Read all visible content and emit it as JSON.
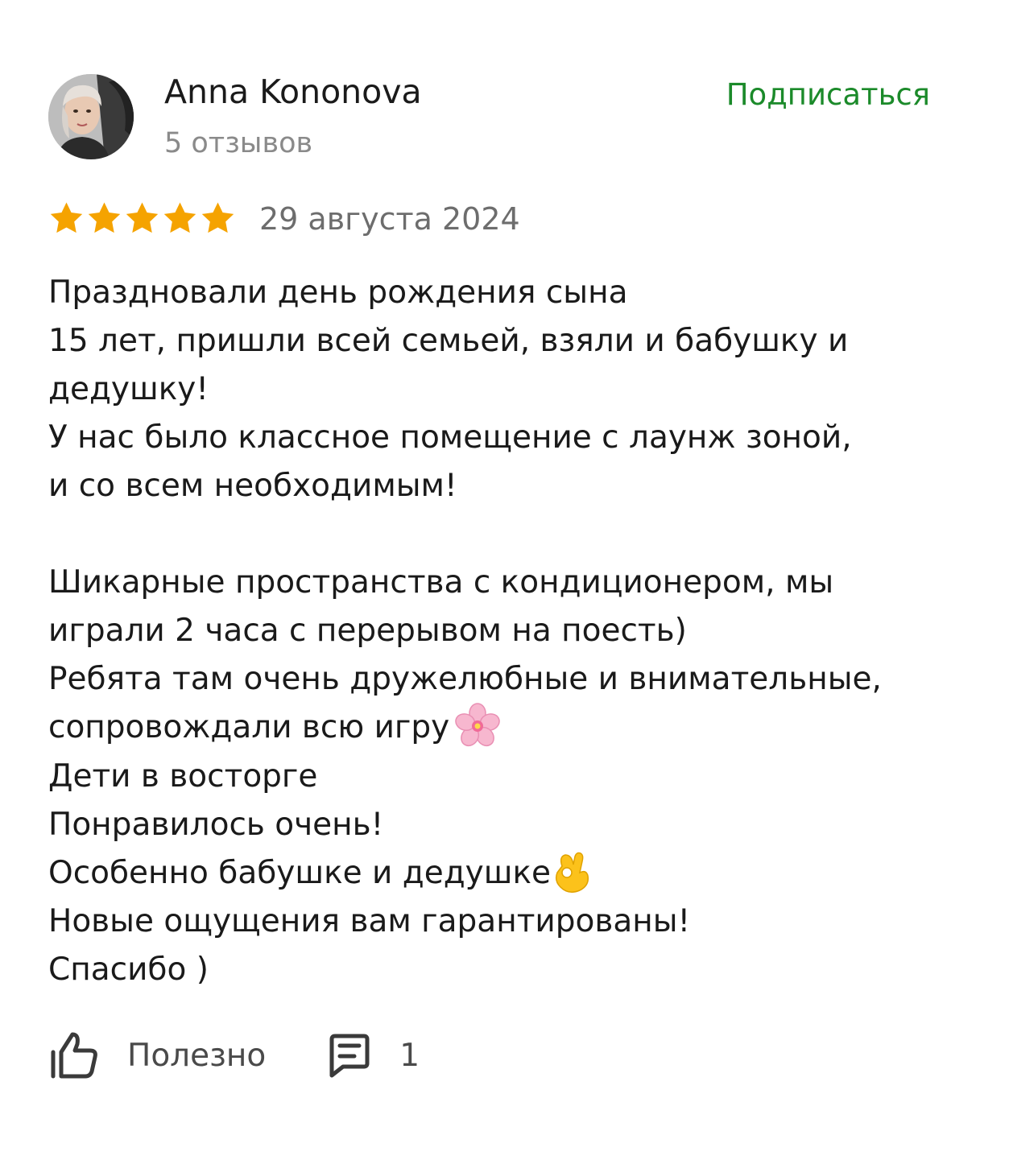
{
  "author": {
    "name": "Anna Kononova",
    "review_count": "5 отзывов",
    "avatar_icon": "user-photo-avatar"
  },
  "subscribe_label": "Подписаться",
  "review": {
    "rating": 5,
    "rating_max": 5,
    "date": "29 августа 2024",
    "lines": [
      "Праздновали день рождения сына",
      "15 лет, пришли всей семьей, взяли и бабушку и",
      "дедушку!",
      "У нас было классное помещение с лаунж зоной,",
      "и со всем необходимым!",
      "",
      "Шикарные пространства с кондиционером, мы",
      "играли 2 часа с перерывом на поесть)",
      "Ребята там очень дружелюбные и внимательные,",
      "сопровождали всю игру",
      "Дети в восторге",
      "Понравилось очень!",
      "Особенно бабушке и дедушке",
      "Новые ощущения вам гарантированы!",
      "Спасибо )"
    ],
    "emojis": {
      "line_9": "cherry-blossom-icon",
      "line_12": "ok-hand-icon"
    }
  },
  "footer": {
    "like_label": "Полезно",
    "like_icon": "thumbs-up-icon",
    "comment_icon": "comment-icon",
    "comment_count": "1"
  },
  "colors": {
    "accent": "#1b8a2a",
    "star": "#f5a300",
    "muted_text": "#8a8a8a",
    "text": "#1a1a1a"
  }
}
